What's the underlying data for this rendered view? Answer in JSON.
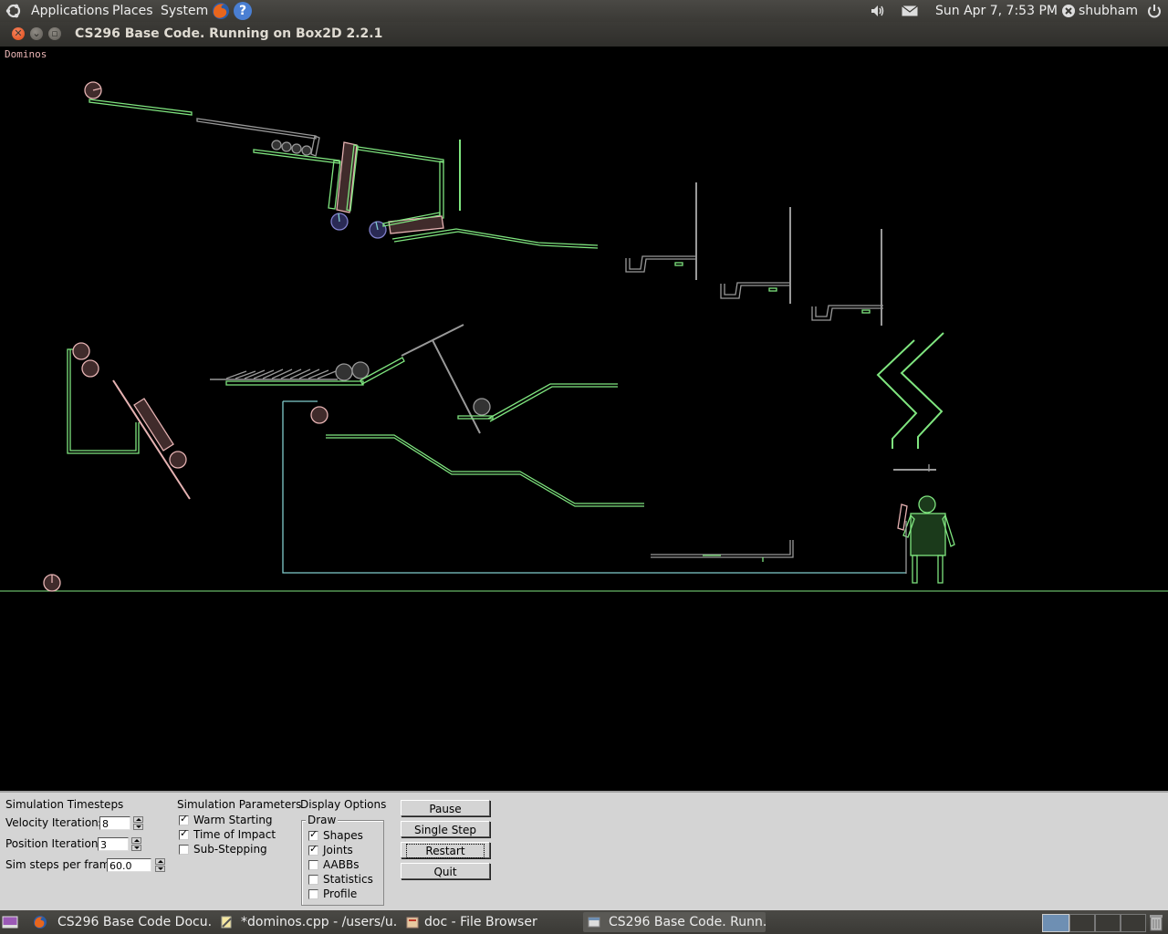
{
  "top_panel": {
    "menus": [
      "Applications",
      "Places",
      "System"
    ],
    "clock": "Sun Apr  7,  7:53 PM",
    "username": "shubham"
  },
  "window": {
    "title": "CS296 Base Code. Running on Box2D 2.2.1"
  },
  "simulation": {
    "test_name": "Dominos"
  },
  "controls": {
    "timesteps": {
      "heading": "Simulation Timesteps",
      "velocity_label": "Velocity Iterations",
      "velocity_value": "8",
      "position_label": "Position Iterations",
      "position_value": "3",
      "hz_label": "Sim steps per frame",
      "hz_value": "60.0"
    },
    "parameters": {
      "heading": "Simulation Parameters",
      "items": [
        {
          "label": "Warm Starting",
          "checked": true
        },
        {
          "label": "Time of Impact",
          "checked": true
        },
        {
          "label": "Sub-Stepping",
          "checked": false
        }
      ]
    },
    "display": {
      "heading": "Display Options",
      "panel_label": "Draw",
      "items": [
        {
          "label": "Shapes",
          "checked": true
        },
        {
          "label": "Joints",
          "checked": true
        },
        {
          "label": "AABBs",
          "checked": false
        },
        {
          "label": "Statistics",
          "checked": false
        },
        {
          "label": "Profile",
          "checked": false
        }
      ]
    },
    "buttons": {
      "pause": "Pause",
      "single_step": "Single Step",
      "restart": "Restart",
      "quit": "Quit"
    }
  },
  "taskbar": {
    "tasks": [
      {
        "label": "CS296 Base Code Docu...",
        "icon": "firefox-icon",
        "active": false
      },
      {
        "label": "*dominos.cpp - /users/u...",
        "icon": "gedit-icon",
        "active": false
      },
      {
        "label": "doc - File Browser",
        "icon": "file-browser-icon",
        "active": false
      },
      {
        "label": "CS296 Base Code. Runn...",
        "icon": "window-icon",
        "active": true
      }
    ]
  },
  "colors": {
    "static_body": "#7fe57f",
    "dynamic_body": "#e5b2b2",
    "sleeping_body": "#999999",
    "joint": "#80cccc",
    "background": "#000000"
  }
}
